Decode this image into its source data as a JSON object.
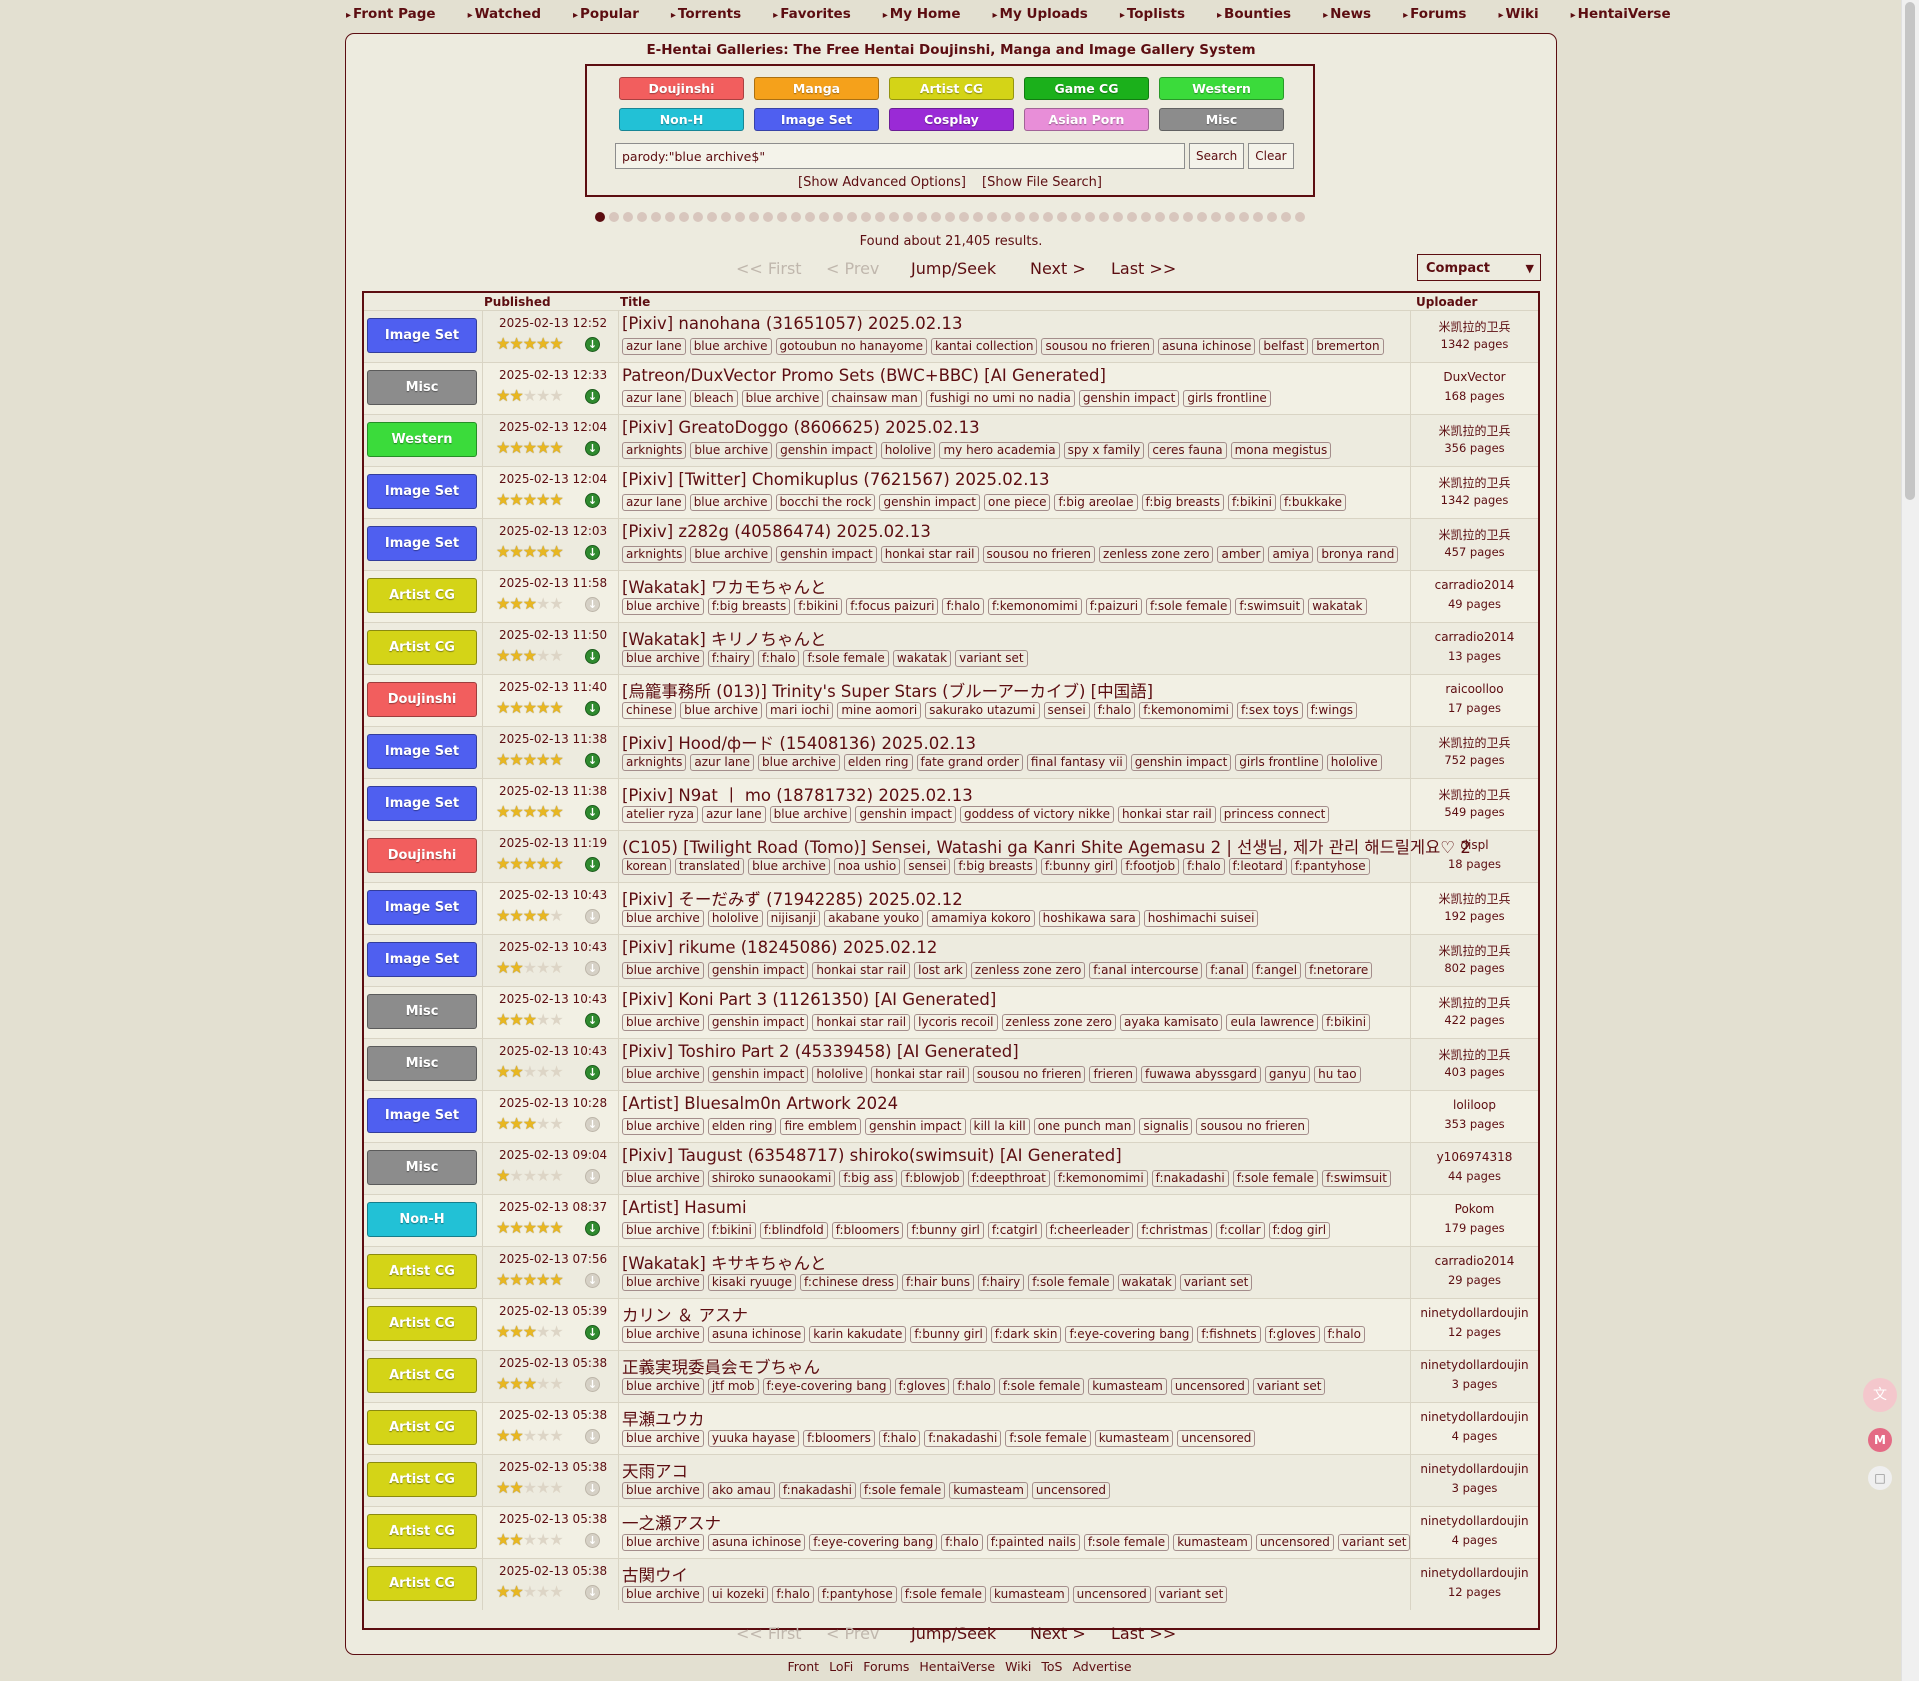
{
  "nav": [
    "Front Page",
    "Watched",
    "Popular",
    "Torrents",
    "Favorites",
    "My Home",
    "My Uploads",
    "Toplists",
    "Bounties",
    "News",
    "Forums",
    "Wiki",
    "HentaiVerse"
  ],
  "site_title": "E-Hentai Galleries: The Free Hentai Doujinshi, Manga and Image Gallery System",
  "categories": [
    {
      "label": "Doujinshi",
      "color": "#f25e5e"
    },
    {
      "label": "Manga",
      "color": "#f5a11b"
    },
    {
      "label": "Artist CG",
      "color": "#d4d417"
    },
    {
      "label": "Game CG",
      "color": "#1bb01b"
    },
    {
      "label": "Western",
      "color": "#3bdb3b"
    },
    {
      "label": "Non-H",
      "color": "#22c1d6"
    },
    {
      "label": "Image Set",
      "color": "#4f5ff0"
    },
    {
      "label": "Cosplay",
      "color": "#9a2ad6"
    },
    {
      "label": "Asian Porn",
      "color": "#e88ed8"
    },
    {
      "label": "Misc",
      "color": "#8c8c8c"
    }
  ],
  "search": {
    "value": "parody:\"blue archive$\"",
    "search_label": "Search",
    "clear_label": "Clear",
    "advanced": "[Show Advanced Options]",
    "file_search": "[Show File Search]"
  },
  "found": "Found about 21,405 results.",
  "pager": {
    "first": "<< First",
    "prev": "< Prev",
    "jump": "Jump/Seek",
    "next": "Next >",
    "last": "Last >>"
  },
  "display_mode": "Compact",
  "table_headers": {
    "published": "Published",
    "title": "Title",
    "uploader": "Uploader"
  },
  "galleries": [
    {
      "category": "Image Set",
      "color": "#4f5ff0",
      "published": "2025-02-13 12:52",
      "rating": 5,
      "torrent": true,
      "title": "[Pixiv] nanohana (31651057) 2025.02.13",
      "tags": [
        "azur lane",
        "blue archive",
        "gotoubun no hanayome",
        "kantai collection",
        "sousou no frieren",
        "asuna ichinose",
        "belfast",
        "bremerton"
      ],
      "uploader": "米凯拉的卫兵",
      "pages": "1342 pages"
    },
    {
      "category": "Misc",
      "color": "#8c8c8c",
      "published": "2025-02-13 12:33",
      "rating": 2,
      "torrent": true,
      "title": "Patreon/DuxVector Promo Sets (BWC+BBC) [AI Generated]",
      "tags": [
        "azur lane",
        "bleach",
        "blue archive",
        "chainsaw man",
        "fushigi no umi no nadia",
        "genshin impact",
        "girls frontline"
      ],
      "uploader": "DuxVector",
      "pages": "168 pages"
    },
    {
      "category": "Western",
      "color": "#3bdb3b",
      "published": "2025-02-13 12:04",
      "rating": 5,
      "torrent": true,
      "title": "[Pixiv] GreatoDoggo (8606625) 2025.02.13",
      "tags": [
        "arknights",
        "blue archive",
        "genshin impact",
        "hololive",
        "my hero academia",
        "spy x family",
        "ceres fauna",
        "mona megistus"
      ],
      "uploader": "米凯拉的卫兵",
      "pages": "356 pages"
    },
    {
      "category": "Image Set",
      "color": "#4f5ff0",
      "published": "2025-02-13 12:04",
      "rating": 5,
      "torrent": true,
      "title": "[Pixiv] [Twitter] Chomikuplus (7621567) 2025.02.13",
      "tags": [
        "azur lane",
        "blue archive",
        "bocchi the rock",
        "genshin impact",
        "one piece",
        "f:big areolae",
        "f:big breasts",
        "f:bikini",
        "f:bukkake"
      ],
      "uploader": "米凯拉的卫兵",
      "pages": "1342 pages"
    },
    {
      "category": "Image Set",
      "color": "#4f5ff0",
      "published": "2025-02-13 12:03",
      "rating": 5,
      "torrent": true,
      "title": "[Pixiv] z282g (40586474) 2025.02.13",
      "tags": [
        "arknights",
        "blue archive",
        "genshin impact",
        "honkai star rail",
        "sousou no frieren",
        "zenless zone zero",
        "amber",
        "amiya",
        "bronya rand"
      ],
      "uploader": "米凯拉的卫兵",
      "pages": "457 pages"
    },
    {
      "category": "Artist CG",
      "color": "#d4d417",
      "published": "2025-02-13 11:58",
      "rating": 3,
      "torrent": false,
      "title": "[Wakatak] ワカモちゃんと",
      "tags": [
        "blue archive",
        "f:big breasts",
        "f:bikini",
        "f:focus paizuri",
        "f:halo",
        "f:kemonomimi",
        "f:paizuri",
        "f:sole female",
        "f:swimsuit",
        "wakatak"
      ],
      "uploader": "carradio2014",
      "pages": "49 pages"
    },
    {
      "category": "Artist CG",
      "color": "#d4d417",
      "published": "2025-02-13 11:50",
      "rating": 3,
      "torrent": true,
      "title": "[Wakatak] キリノちゃんと",
      "tags": [
        "blue archive",
        "f:hairy",
        "f:halo",
        "f:sole female",
        "wakatak",
        "variant set"
      ],
      "uploader": "carradio2014",
      "pages": "13 pages"
    },
    {
      "category": "Doujinshi",
      "color": "#f25e5e",
      "published": "2025-02-13 11:40",
      "rating": 5,
      "torrent": true,
      "title": "[烏籠事務所 (013)] Trinity's Super Stars (ブルーアーカイブ) [中国語]",
      "tags": [
        "chinese",
        "blue archive",
        "mari iochi",
        "mine aomori",
        "sakurako utazumi",
        "sensei",
        "f:halo",
        "f:kemonomimi",
        "f:sex toys",
        "f:wings"
      ],
      "uploader": "raicoolloo",
      "pages": "17 pages"
    },
    {
      "category": "Image Set",
      "color": "#4f5ff0",
      "published": "2025-02-13 11:38",
      "rating": 5,
      "torrent": true,
      "title": "[Pixiv] Hood/фード (15408136) 2025.02.13",
      "tags": [
        "arknights",
        "azur lane",
        "blue archive",
        "elden ring",
        "fate grand order",
        "final fantasy vii",
        "genshin impact",
        "girls frontline",
        "hololive"
      ],
      "uploader": "米凯拉的卫兵",
      "pages": "752 pages"
    },
    {
      "category": "Image Set",
      "color": "#4f5ff0",
      "published": "2025-02-13 11:38",
      "rating": 5,
      "torrent": true,
      "title": "[Pixiv] N9at 丨 mo (18781732) 2025.02.13",
      "tags": [
        "atelier ryza",
        "azur lane",
        "blue archive",
        "genshin impact",
        "goddess of victory nikke",
        "honkai star rail",
        "princess connect"
      ],
      "uploader": "米凯拉的卫兵",
      "pages": "549 pages"
    },
    {
      "category": "Doujinshi",
      "color": "#f25e5e",
      "published": "2025-02-13 11:19",
      "rating": 5,
      "torrent": true,
      "title": "(C105) [Twilight Road (Tomo)] Sensei, Watashi ga Kanri Shite Agemasu 2 | 선생님, 제가 관리 해드릴게요♡ 2",
      "tags": [
        "korean",
        "translated",
        "blue archive",
        "noa ushio",
        "sensei",
        "f:big breasts",
        "f:bunny girl",
        "f:footjob",
        "f:halo",
        "f:leotard",
        "f:pantyhose"
      ],
      "uploader": "displ",
      "pages": "18 pages"
    },
    {
      "category": "Image Set",
      "color": "#4f5ff0",
      "published": "2025-02-13 10:43",
      "rating": 4,
      "torrent": false,
      "title": "[Pixiv] そーだみず (71942285) 2025.02.12",
      "tags": [
        "blue archive",
        "hololive",
        "nijisanji",
        "akabane youko",
        "amamiya kokoro",
        "hoshikawa sara",
        "hoshimachi suisei"
      ],
      "uploader": "米凯拉的卫兵",
      "pages": "192 pages"
    },
    {
      "category": "Image Set",
      "color": "#4f5ff0",
      "published": "2025-02-13 10:43",
      "rating": 2,
      "torrent": false,
      "title": "[Pixiv] rikume (18245086) 2025.02.12",
      "tags": [
        "blue archive",
        "genshin impact",
        "honkai star rail",
        "lost ark",
        "zenless zone zero",
        "f:anal intercourse",
        "f:anal",
        "f:angel",
        "f:netorare"
      ],
      "uploader": "米凯拉的卫兵",
      "pages": "802 pages"
    },
    {
      "category": "Misc",
      "color": "#8c8c8c",
      "published": "2025-02-13 10:43",
      "rating": 3,
      "torrent": true,
      "title": "[Pixiv] Koni Part 3 (11261350) [AI Generated]",
      "tags": [
        "blue archive",
        "genshin impact",
        "honkai star rail",
        "lycoris recoil",
        "zenless zone zero",
        "ayaka kamisato",
        "eula lawrence",
        "f:bikini"
      ],
      "uploader": "米凯拉的卫兵",
      "pages": "422 pages"
    },
    {
      "category": "Misc",
      "color": "#8c8c8c",
      "published": "2025-02-13 10:43",
      "rating": 2,
      "torrent": true,
      "title": "[Pixiv] Toshiro Part 2 (45339458) [AI Generated]",
      "tags": [
        "blue archive",
        "genshin impact",
        "hololive",
        "honkai star rail",
        "sousou no frieren",
        "frieren",
        "fuwawa abyssgard",
        "ganyu",
        "hu tao"
      ],
      "uploader": "米凯拉的卫兵",
      "pages": "403 pages"
    },
    {
      "category": "Image Set",
      "color": "#4f5ff0",
      "published": "2025-02-13 10:28",
      "rating": 3,
      "torrent": false,
      "title": "[Artist] Bluesalm0n Artwork 2024",
      "tags": [
        "blue archive",
        "elden ring",
        "fire emblem",
        "genshin impact",
        "kill la kill",
        "one punch man",
        "signalis",
        "sousou no frieren"
      ],
      "uploader": "loliloop",
      "pages": "353 pages"
    },
    {
      "category": "Misc",
      "color": "#8c8c8c",
      "published": "2025-02-13 09:04",
      "rating": 1,
      "torrent": false,
      "title": "[Pixiv] Taugust (63548717) shiroko(swimsuit) [AI Generated]",
      "tags": [
        "blue archive",
        "shiroko sunaookami",
        "f:big ass",
        "f:blowjob",
        "f:deepthroat",
        "f:kemonomimi",
        "f:nakadashi",
        "f:sole female",
        "f:swimsuit"
      ],
      "uploader": "y106974318",
      "pages": "44 pages"
    },
    {
      "category": "Non-H",
      "color": "#22c1d6",
      "published": "2025-02-13 08:37",
      "rating": 5,
      "torrent": true,
      "title": "[Artist] Hasumi",
      "tags": [
        "blue archive",
        "f:bikini",
        "f:blindfold",
        "f:bloomers",
        "f:bunny girl",
        "f:catgirl",
        "f:cheerleader",
        "f:christmas",
        "f:collar",
        "f:dog girl"
      ],
      "uploader": "Pokom",
      "pages": "179 pages"
    },
    {
      "category": "Artist CG",
      "color": "#d4d417",
      "published": "2025-02-13 07:56",
      "rating": 5,
      "torrent": false,
      "title": "[Wakatak] キサキちゃんと",
      "tags": [
        "blue archive",
        "kisaki ryuuge",
        "f:chinese dress",
        "f:hair buns",
        "f:hairy",
        "f:sole female",
        "wakatak",
        "variant set"
      ],
      "uploader": "carradio2014",
      "pages": "29 pages"
    },
    {
      "category": "Artist CG",
      "color": "#d4d417",
      "published": "2025-02-13 05:39",
      "rating": 3,
      "torrent": true,
      "title": "カリン ＆ アスナ",
      "tags": [
        "blue archive",
        "asuna ichinose",
        "karin kakudate",
        "f:bunny girl",
        "f:dark skin",
        "f:eye-covering bang",
        "f:fishnets",
        "f:gloves",
        "f:halo"
      ],
      "uploader": "ninetydollardoujin",
      "pages": "12 pages"
    },
    {
      "category": "Artist CG",
      "color": "#d4d417",
      "published": "2025-02-13 05:38",
      "rating": 3,
      "torrent": false,
      "title": "正義実現委員会モブちゃん",
      "tags": [
        "blue archive",
        "jtf mob",
        "f:eye-covering bang",
        "f:gloves",
        "f:halo",
        "f:sole female",
        "kumasteam",
        "uncensored",
        "variant set"
      ],
      "uploader": "ninetydollardoujin",
      "pages": "3 pages"
    },
    {
      "category": "Artist CG",
      "color": "#d4d417",
      "published": "2025-02-13 05:38",
      "rating": 2,
      "torrent": false,
      "title": "早瀬ユウカ",
      "tags": [
        "blue archive",
        "yuuka hayase",
        "f:bloomers",
        "f:halo",
        "f:nakadashi",
        "f:sole female",
        "kumasteam",
        "uncensored"
      ],
      "uploader": "ninetydollardoujin",
      "pages": "4 pages"
    },
    {
      "category": "Artist CG",
      "color": "#d4d417",
      "published": "2025-02-13 05:38",
      "rating": 2,
      "torrent": false,
      "title": "天雨アコ",
      "tags": [
        "blue archive",
        "ako amau",
        "f:nakadashi",
        "f:sole female",
        "kumasteam",
        "uncensored"
      ],
      "uploader": "ninetydollardoujin",
      "pages": "3 pages"
    },
    {
      "category": "Artist CG",
      "color": "#d4d417",
      "published": "2025-02-13 05:38",
      "rating": 2,
      "torrent": false,
      "title": "一之瀬アスナ",
      "tags": [
        "blue archive",
        "asuna ichinose",
        "f:eye-covering bang",
        "f:halo",
        "f:painted nails",
        "f:sole female",
        "kumasteam",
        "uncensored",
        "variant set"
      ],
      "uploader": "ninetydollardoujin",
      "pages": "4 pages"
    },
    {
      "category": "Artist CG",
      "color": "#d4d417",
      "published": "2025-02-13 05:38",
      "rating": 2,
      "torrent": false,
      "title": "古関ウイ",
      "tags": [
        "blue archive",
        "ui kozeki",
        "f:halo",
        "f:pantyhose",
        "f:sole female",
        "kumasteam",
        "uncensored",
        "variant set"
      ],
      "uploader": "ninetydollardoujin",
      "pages": "12 pages"
    }
  ],
  "footer": [
    "Front",
    "LoFi",
    "Forums",
    "HentaiVerse",
    "Wiki",
    "ToS",
    "Advertise"
  ]
}
